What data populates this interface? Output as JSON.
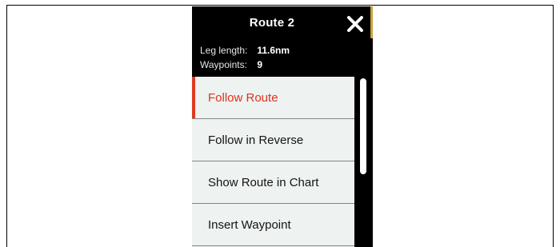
{
  "header": {
    "title": "Route 2",
    "leg_length_label": "Leg length:",
    "leg_length_value": "11.6nm",
    "waypoints_label": "Waypoints:",
    "waypoints_value": "9"
  },
  "menu": {
    "items": [
      {
        "label": "Follow Route",
        "selected": true
      },
      {
        "label": "Follow in Reverse",
        "selected": false
      },
      {
        "label": "Show Route in Chart",
        "selected": false
      },
      {
        "label": "Insert Waypoint",
        "selected": false
      }
    ]
  },
  "icons": {
    "close": "close-icon"
  },
  "colors": {
    "header_bg": "#000000",
    "menu_bg": "#eef2f1",
    "selected_text": "#e0321e",
    "selected_bar": "#e03a22"
  }
}
